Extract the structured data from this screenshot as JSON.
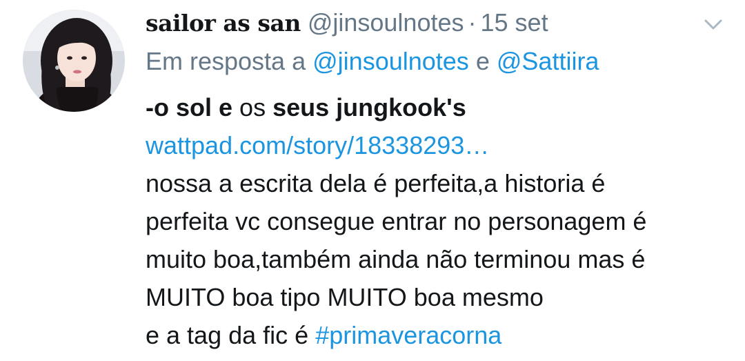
{
  "tweet": {
    "display_name": "sailor as san",
    "handle": "@jinsoulnotes",
    "separator": "·",
    "date": "15 set",
    "reply": {
      "prefix": "Em resposta a",
      "user1": "@jinsoulnotes",
      "conjunction": "e",
      "user2": "@Sattiira"
    },
    "body": {
      "title_dash_part": "-o sol e",
      "title_middle": "os",
      "title_end": "seus jungkook's",
      "link": "wattpad.com/story/18338293…",
      "line1": "nossa a escrita dela é perfeita,a historia é",
      "line2": "perfeita vc consegue entrar no personagem é",
      "line3": "muito boa,também ainda não terminou mas é",
      "line4": "MUITO boa tipo MUITO boa mesmo",
      "line5_text": "e a tag da fic é",
      "hashtag": "#primaveracorna"
    },
    "icons": {
      "avatar": "profile-photo",
      "menu": "chevron-down-icon"
    },
    "colors": {
      "link": "#1b95e0",
      "secondary_text": "#657786",
      "primary_text": "#14171a"
    }
  }
}
